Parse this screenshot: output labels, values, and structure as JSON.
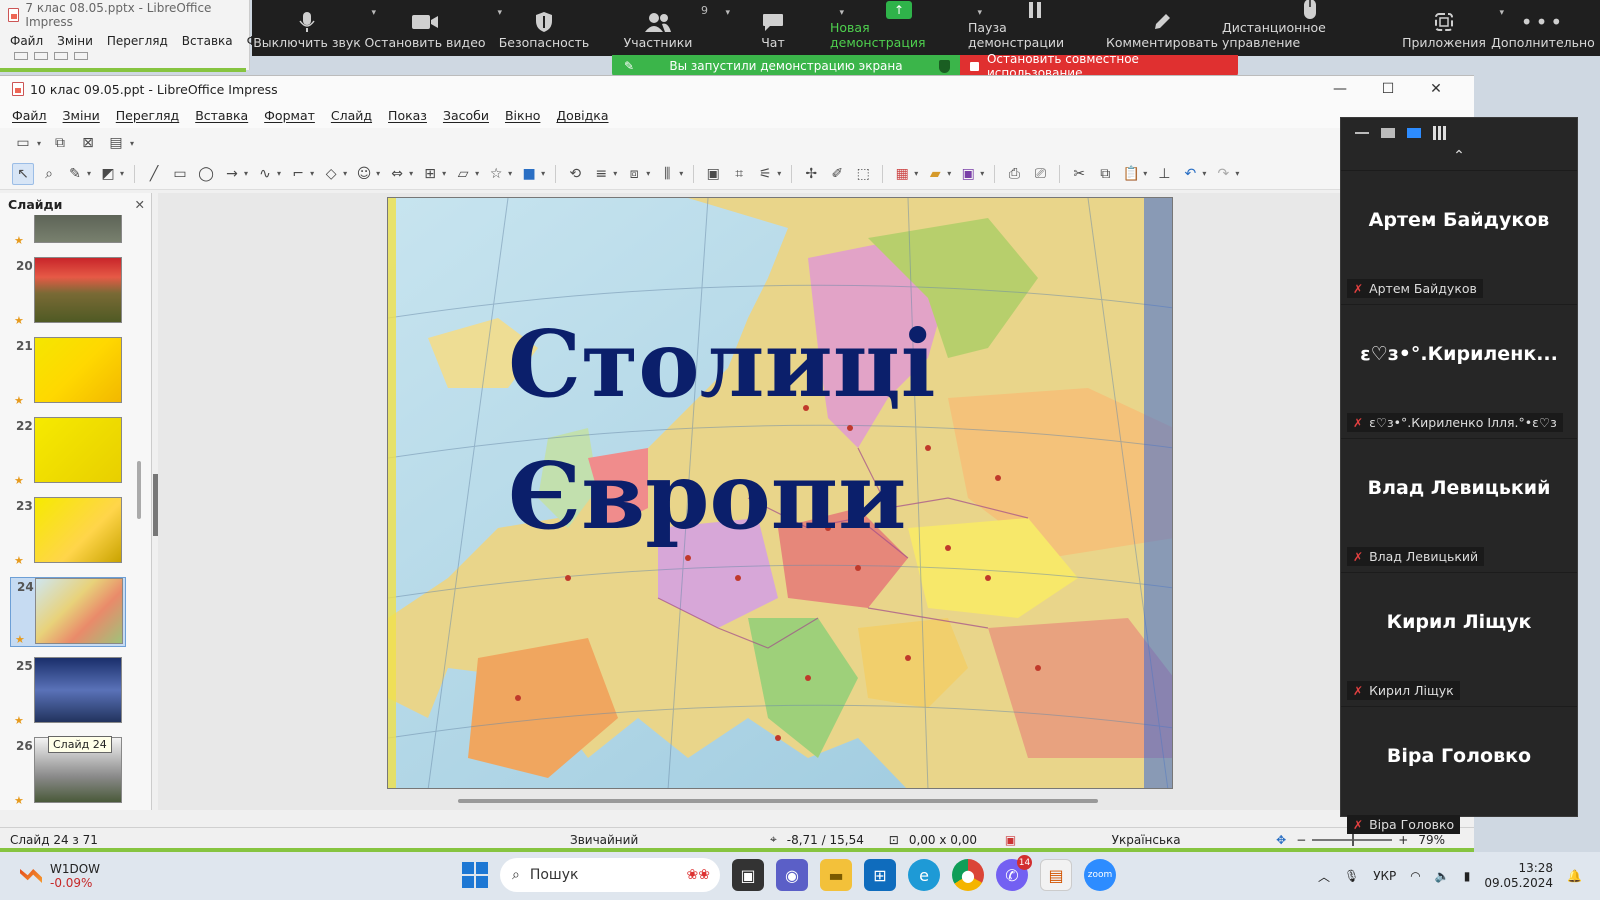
{
  "background_window": {
    "title": "7 клас 08.05.pptx - LibreOffice Impress",
    "menu": [
      "Файл",
      "Зміни",
      "Перегляд",
      "Вставка",
      "Фо"
    ]
  },
  "zoom_toolbar": {
    "items": [
      {
        "label": "Выключить звук",
        "icon": "microphone-icon"
      },
      {
        "label": "Остановить видео",
        "icon": "video-camera-icon"
      },
      {
        "label": "Безопасность",
        "icon": "shield-icon"
      },
      {
        "label": "Участники",
        "icon": "participants-icon",
        "count": "9"
      },
      {
        "label": "Чат",
        "icon": "chat-icon"
      },
      {
        "label": "Новая демонстрация",
        "icon": "share-screen-icon"
      },
      {
        "label": "Пауза демонстрации",
        "icon": "pause-icon"
      },
      {
        "label": "Комментировать",
        "icon": "pencil-icon"
      },
      {
        "label": "Дистанционное управление",
        "icon": "mouse-icon"
      },
      {
        "label": "Приложения",
        "icon": "apps-icon"
      },
      {
        "label": "Дополнительно",
        "icon": "more-icon"
      }
    ],
    "share_status": "Вы запустили демонстрацию экрана",
    "stop_sharing": "Остановить совместное использование"
  },
  "window": {
    "title": "10 клас 09.05.ppt - LibreOffice Impress",
    "menu": [
      "Файл",
      "Зміни",
      "Перегляд",
      "Вставка",
      "Формат",
      "Слайд",
      "Показ",
      "Засоби",
      "Вікно",
      "Довідка"
    ]
  },
  "slides_pane": {
    "title": "Слайди",
    "slides": [
      {
        "number": "",
        "theme": "dark"
      },
      {
        "number": "20",
        "theme": "tulips"
      },
      {
        "number": "21",
        "theme": "yellow"
      },
      {
        "number": "22",
        "theme": "yellow"
      },
      {
        "number": "23",
        "theme": "yellow"
      },
      {
        "number": "24",
        "theme": "map",
        "selected": true
      },
      {
        "number": "25",
        "theme": "bridge"
      },
      {
        "number": "26",
        "theme": "eiffel"
      }
    ],
    "tooltip": "Слайд 24"
  },
  "slide": {
    "title_line1": "Столиці",
    "title_line2": "Європи"
  },
  "status_bar": {
    "slide_info": "Слайд 24 з 71",
    "layout": "Звичайний",
    "position": "-8,71 / 15,54",
    "size": "0,00 x 0,00",
    "language": "Українська",
    "zoom": "79%"
  },
  "participants": [
    {
      "big": "Артем Байдуков",
      "small": "Артем Байдуков"
    },
    {
      "big": "ε♡з•°.Кириленк...",
      "small": "ε♡з•°.Кириленко Ілля.°•ε♡з"
    },
    {
      "big": "Влад Левицький",
      "small": "Влад Левицький"
    },
    {
      "big": "Кирил Ліщук",
      "small": "Кирил Ліщук"
    },
    {
      "big": "Віра Головко",
      "small": "Віра Головко"
    }
  ],
  "taskbar": {
    "stock_name": "W1DOW",
    "stock_change": "-0.09%",
    "search_placeholder": "Пошук",
    "messenger_badge": "14",
    "keyboard_lang": "УКР",
    "time": "13:28",
    "date": "09.05.2024"
  },
  "colors": {
    "zoom_bar": "#1f1f1f",
    "share_green": "#3bb54a",
    "stop_red": "#e03030",
    "slide_title": "#0b1f6b",
    "highlight": "#86c440"
  }
}
